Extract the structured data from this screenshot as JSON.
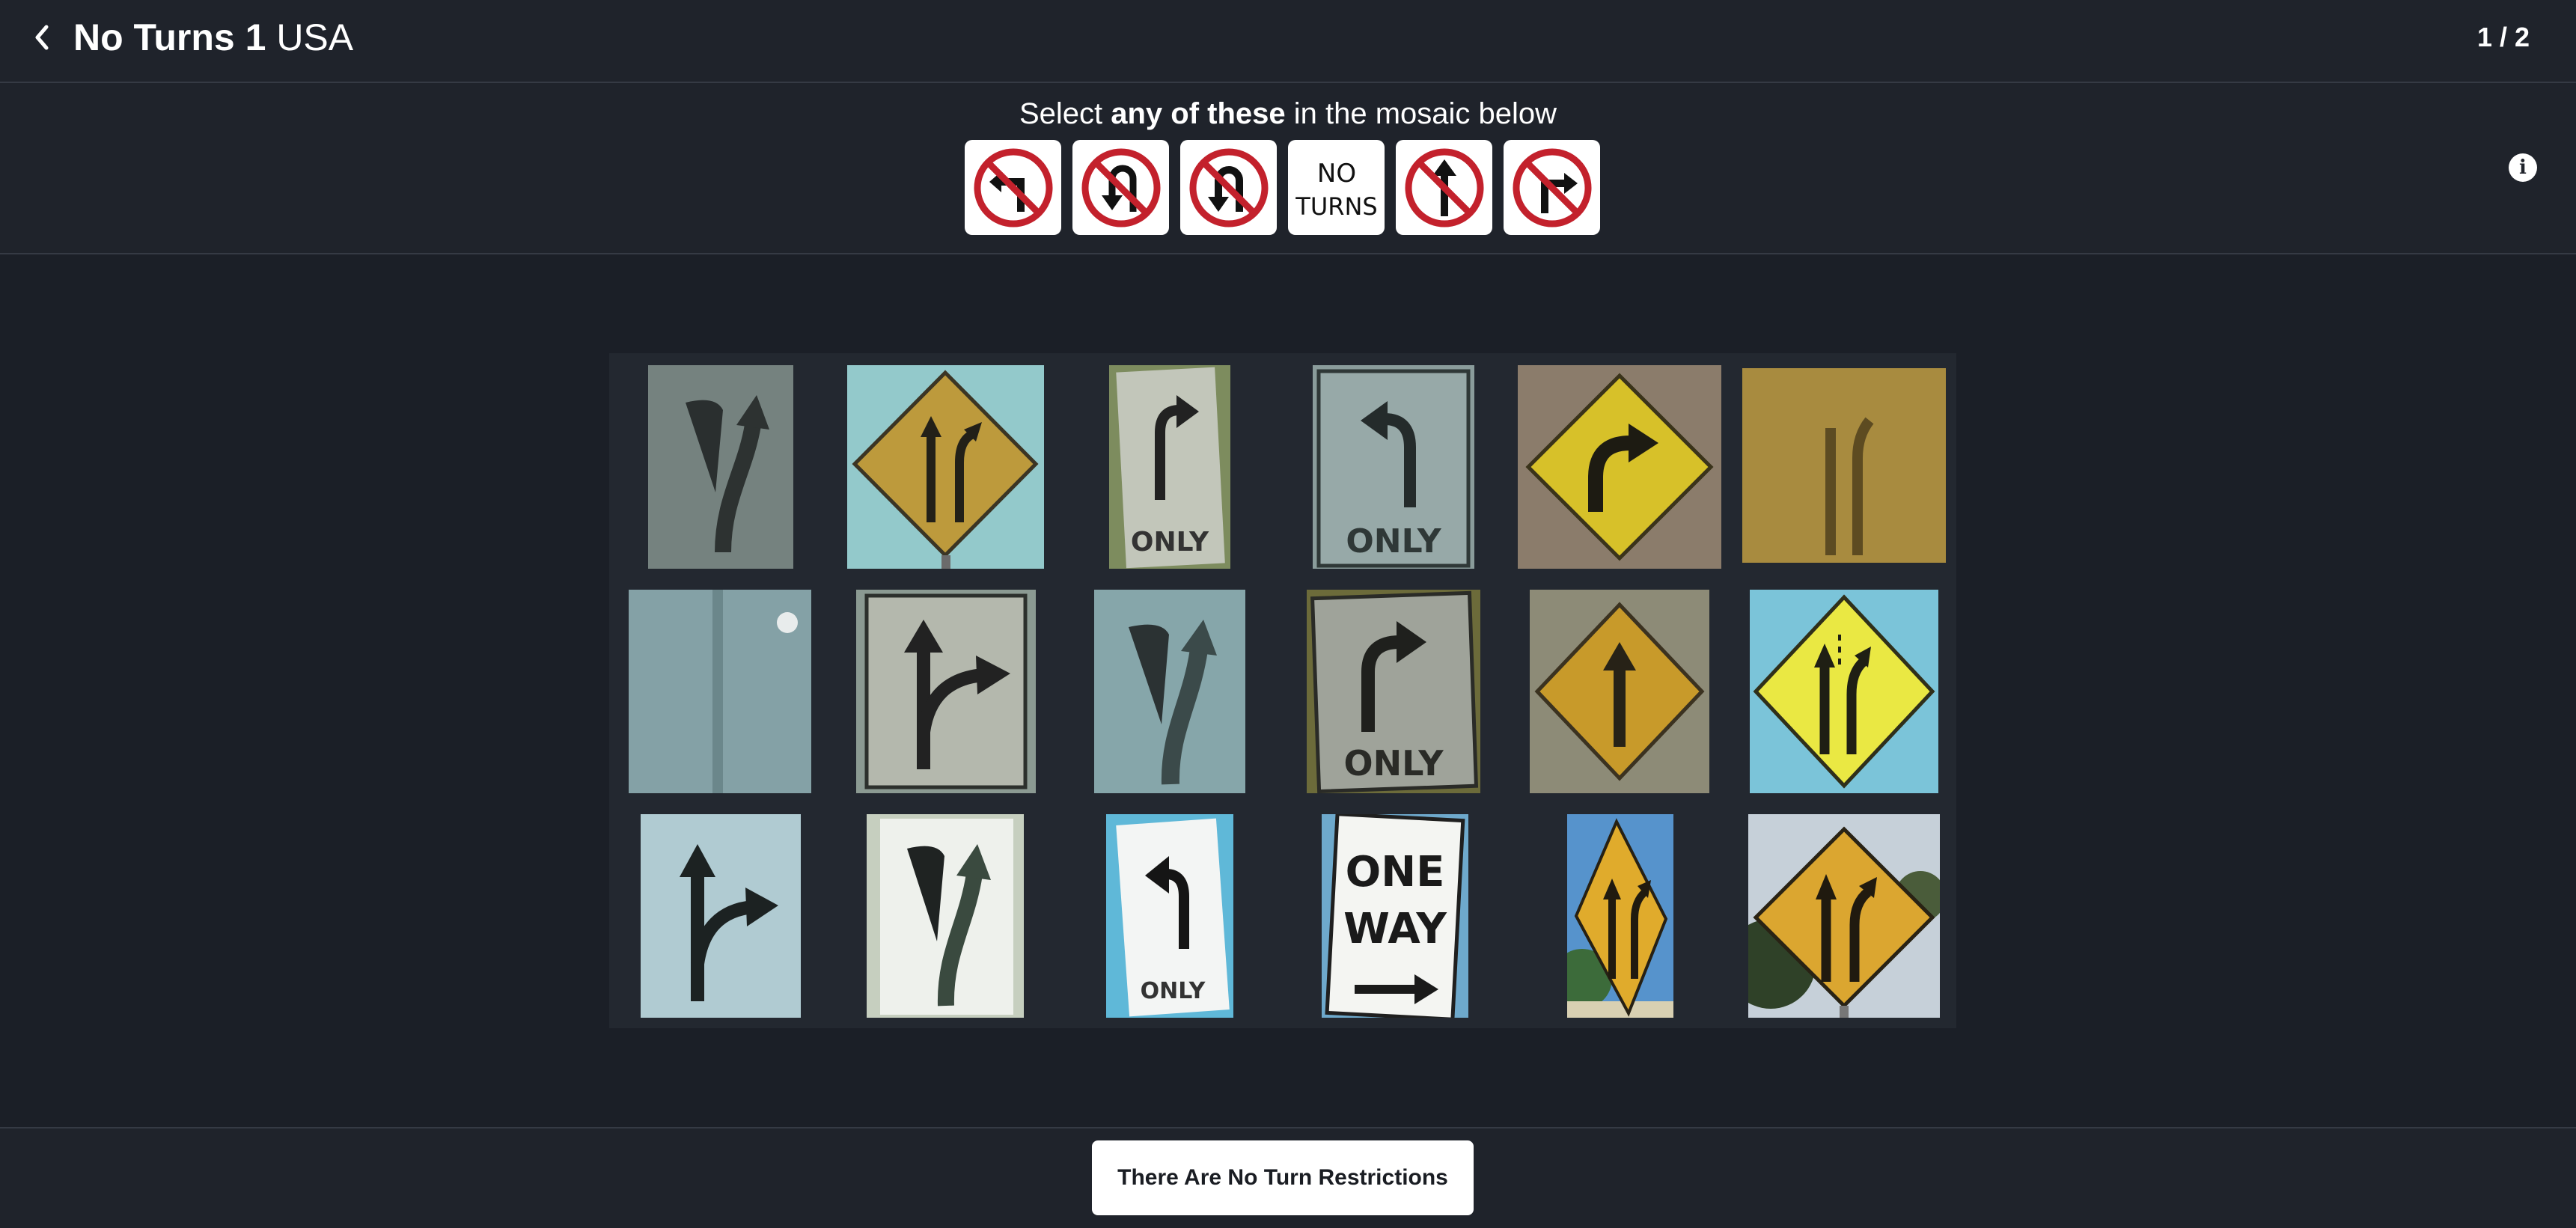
{
  "header": {
    "title_strong": "No Turns 1",
    "title_rest": " USA",
    "page_indicator": "1 / 2",
    "back_icon": "chevron-left-icon"
  },
  "prompt": {
    "pre": "Select ",
    "bold": "any of these",
    "post": " in the mosaic below",
    "info_icon": "info-icon"
  },
  "examples": [
    {
      "name": "no-left-turn-sign"
    },
    {
      "name": "no-u-turn-sign"
    },
    {
      "name": "no-u-turn-sign-alt"
    },
    {
      "name": "no-turns-text-sign",
      "line1": "NO",
      "line2": "TURNS"
    },
    {
      "name": "no-straight-through-sign"
    },
    {
      "name": "no-right-turn-sign"
    }
  ],
  "tiles": [
    {
      "name": "keep-right-island-sign-1"
    },
    {
      "name": "lane-merge-diamond-sign-1"
    },
    {
      "name": "right-turn-only-sign-1",
      "text": "ONLY"
    },
    {
      "name": "left-turn-only-sign-1",
      "text": "ONLY"
    },
    {
      "name": "right-curve-diamond-sign"
    },
    {
      "name": "blurry-merge-sign"
    },
    {
      "name": "sign-back-panel"
    },
    {
      "name": "straight-or-right-sign-1"
    },
    {
      "name": "keep-right-island-sign-2"
    },
    {
      "name": "right-turn-only-sign-2",
      "text": "ONLY"
    },
    {
      "name": "ahead-arrow-diamond-sign"
    },
    {
      "name": "added-lane-diamond-sign"
    },
    {
      "name": "straight-or-right-sign-2"
    },
    {
      "name": "keep-right-island-sign-3"
    },
    {
      "name": "left-turn-only-sign-2",
      "text": "ONLY"
    },
    {
      "name": "one-way-sign",
      "line1": "ONE",
      "line2": "WAY"
    },
    {
      "name": "lane-merge-diamond-sign-2"
    },
    {
      "name": "lane-merge-diamond-sign-3"
    }
  ],
  "footer": {
    "button_label": "There Are No Turn Restrictions"
  }
}
